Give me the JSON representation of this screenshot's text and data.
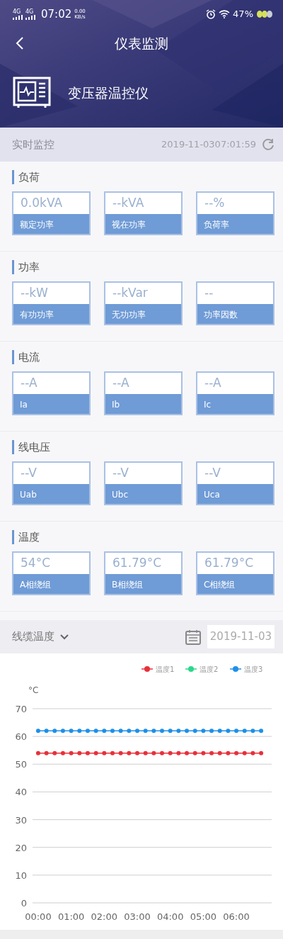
{
  "status_bar": {
    "network": [
      "4G",
      "4G"
    ],
    "time": "07:02",
    "speed": "0.00",
    "speed_unit": "KB/s",
    "battery": "47%"
  },
  "nav": {
    "title": "仪表监测"
  },
  "device": {
    "name": "变压器温控仪"
  },
  "realtime": {
    "label": "实时监控",
    "timestamp": "2019-11-0307:01:59"
  },
  "sections": [
    {
      "title": "负荷",
      "metrics": [
        {
          "value": "0.0kVA",
          "label": "额定功率"
        },
        {
          "value": "--kVA",
          "label": "视在功率"
        },
        {
          "value": "--%",
          "label": "负荷率"
        }
      ]
    },
    {
      "title": "功率",
      "metrics": [
        {
          "value": "--kW",
          "label": "有功功率"
        },
        {
          "value": "--kVar",
          "label": "无功功率"
        },
        {
          "value": "--",
          "label": "功率因数"
        }
      ]
    },
    {
      "title": "电流",
      "metrics": [
        {
          "value": "--A",
          "label": "Ia"
        },
        {
          "value": "--A",
          "label": "Ib"
        },
        {
          "value": "--A",
          "label": "Ic"
        }
      ]
    },
    {
      "title": "线电压",
      "metrics": [
        {
          "value": "--V",
          "label": "Uab"
        },
        {
          "value": "--V",
          "label": "Ubc"
        },
        {
          "value": "--V",
          "label": "Uca"
        }
      ]
    },
    {
      "title": "温度",
      "metrics": [
        {
          "value": "54°C",
          "label": "A相绕组"
        },
        {
          "value": "61.79°C",
          "label": "B相绕组"
        },
        {
          "value": "61.79°C",
          "label": "C相绕组"
        }
      ]
    }
  ],
  "trend": {
    "selector": "线缆温度",
    "date": "2019-11-03",
    "chart_data": {
      "type": "line",
      "ylabel": "°C",
      "grid": true,
      "legend": "top-right",
      "x": [
        0,
        0.25,
        0.5,
        0.75,
        1,
        1.25,
        1.5,
        1.75,
        2,
        2.25,
        2.5,
        2.75,
        3,
        3.25,
        3.5,
        3.75,
        4,
        4.25,
        4.5,
        4.75,
        5,
        5.25,
        5.5,
        5.75,
        6,
        6.25,
        6.5,
        6.75
      ],
      "series": [
        {
          "name": "温度1",
          "color": "#e8303a",
          "marker": "circle",
          "values": [
            54,
            54,
            54,
            54,
            54,
            54,
            54,
            54,
            54,
            54,
            54,
            54,
            54,
            54,
            54,
            54,
            54,
            54,
            54,
            54,
            54,
            54,
            54,
            54,
            54,
            54,
            54,
            54
          ]
        },
        {
          "name": "温度2",
          "color": "#2ad88a",
          "marker": "circle",
          "values": [
            null,
            null,
            null,
            null,
            null,
            null,
            null,
            null,
            null,
            null,
            null,
            null,
            null,
            null,
            null,
            null,
            null,
            null,
            null,
            null,
            null,
            null,
            null,
            null,
            null,
            null,
            null,
            null
          ]
        },
        {
          "name": "温度3",
          "color": "#1e90e8",
          "marker": "circle",
          "values": [
            62,
            62,
            62,
            62,
            62,
            62,
            62,
            62,
            62,
            62,
            62,
            62,
            62,
            62,
            62,
            62,
            62,
            62,
            62,
            62,
            62,
            62,
            62,
            62,
            62,
            62,
            62,
            62
          ]
        }
      ],
      "xlim": [
        -0.17,
        7.07
      ],
      "ylim": [
        0,
        70
      ],
      "yticks": [
        0,
        10,
        20,
        30,
        40,
        50,
        60,
        70
      ],
      "xticks": [
        {
          "value": 0,
          "label": "00:00"
        },
        {
          "value": 1,
          "label": "01:00"
        },
        {
          "value": 2,
          "label": "02:00"
        },
        {
          "value": 3,
          "label": "03:00"
        },
        {
          "value": 4,
          "label": "04:00"
        },
        {
          "value": 5,
          "label": "05:00"
        },
        {
          "value": 6,
          "label": "06:00"
        }
      ]
    }
  }
}
